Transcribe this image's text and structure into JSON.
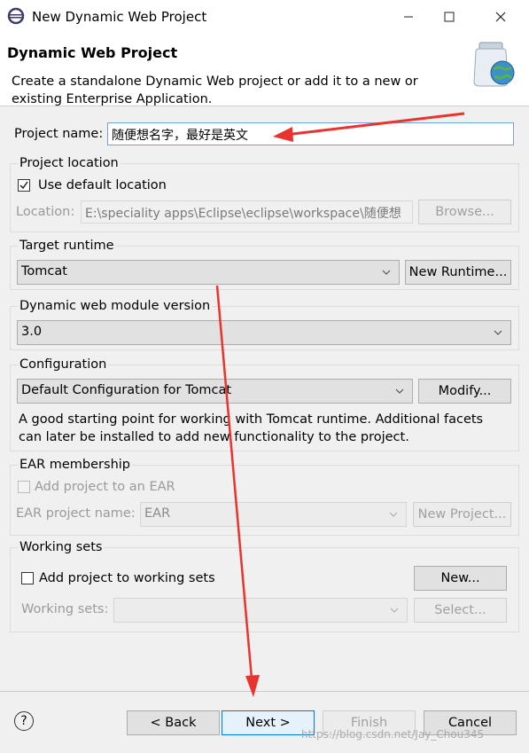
{
  "window": {
    "title": "New Dynamic Web Project",
    "controls": [
      "minimize",
      "maximize",
      "close"
    ]
  },
  "header": {
    "title": "Dynamic Web Project",
    "description_line1": "Create a standalone Dynamic Web project or add it to a new or",
    "description_line2": "existing Enterprise Application."
  },
  "project_name": {
    "label": "Project name:",
    "value": "随便想名字，最好是英文"
  },
  "project_location": {
    "group_label": "Project location",
    "use_default_label": "Use default location",
    "use_default_checked": true,
    "location_label": "Location:",
    "location_value": "E:\\speciality apps\\Eclipse\\eclipse\\workspace\\随便想",
    "browse_label": "Browse..."
  },
  "target_runtime": {
    "group_label": "Target runtime",
    "selected": "Tomcat",
    "new_runtime_label": "New Runtime..."
  },
  "module_version": {
    "group_label": "Dynamic web module version",
    "selected": "3.0"
  },
  "configuration": {
    "group_label": "Configuration",
    "selected": "Default Configuration for Tomcat",
    "modify_label": "Modify...",
    "description_line1": "A good starting point for working with Tomcat runtime. Additional facets",
    "description_line2": "can later be installed to add new functionality to the project."
  },
  "ear": {
    "group_label": "EAR membership",
    "add_label": "Add project to an EAR",
    "add_checked": false,
    "name_label": "EAR project name:",
    "name_value": "EAR",
    "new_project_label": "New Project..."
  },
  "working_sets": {
    "group_label": "Working sets",
    "add_label": "Add project to working sets",
    "add_checked": false,
    "new_label": "New...",
    "sets_label": "Working sets:",
    "sets_value": "",
    "select_label": "Select..."
  },
  "footer": {
    "back_label": "< Back",
    "next_label": "Next >",
    "finish_label": "Finish",
    "cancel_label": "Cancel"
  },
  "watermark": "https://blog.csdn.net/Jay_Chou345",
  "colors": {
    "annotation_arrow": "#e8332e",
    "focus_border": "#0078d7"
  }
}
